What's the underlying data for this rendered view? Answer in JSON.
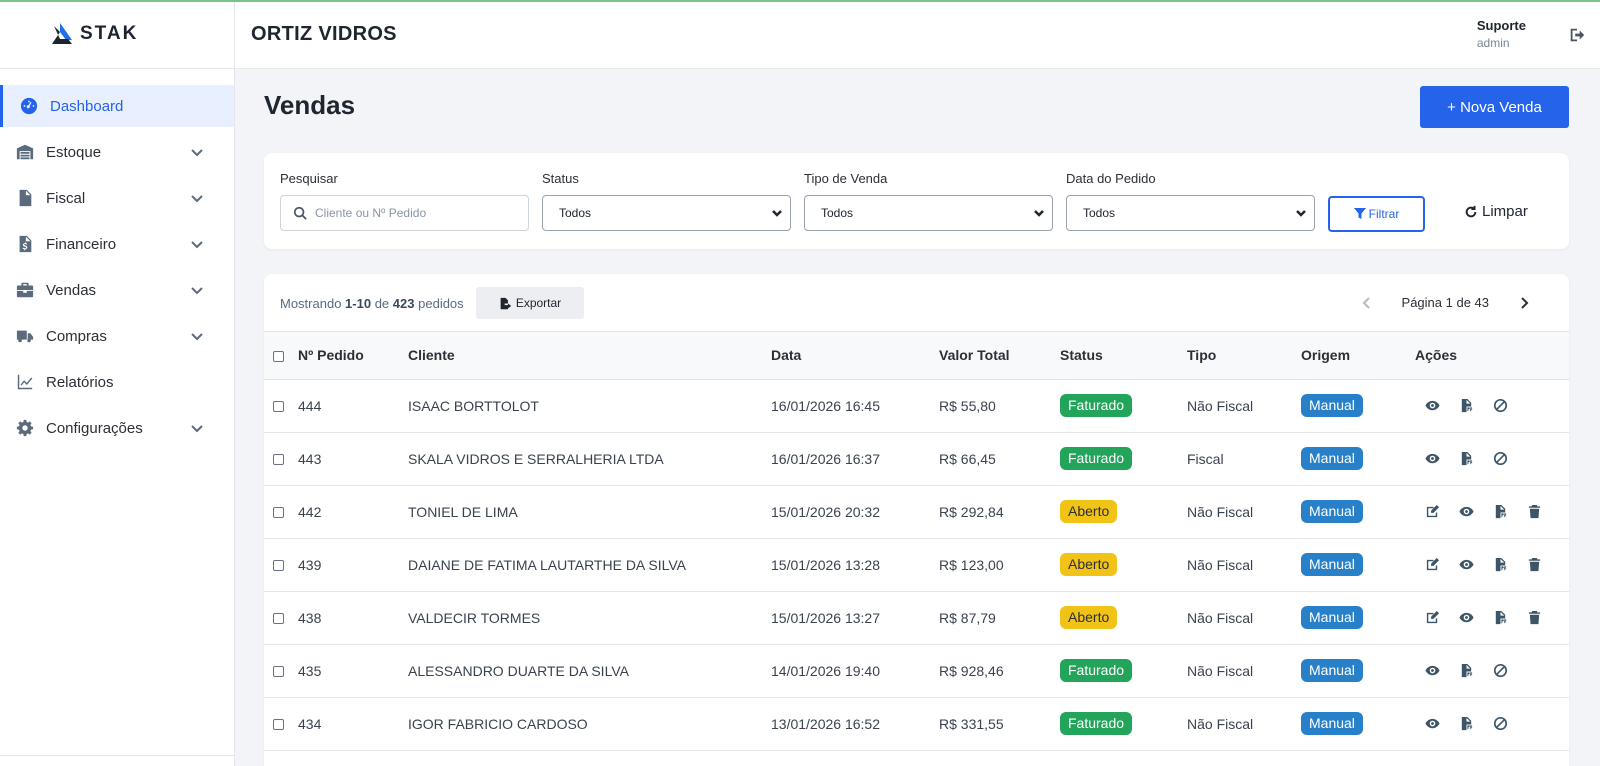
{
  "brand": {
    "name": "STAK"
  },
  "header": {
    "company": "ORTIZ VIDROS",
    "user_name": "Suporte",
    "user_role": "admin"
  },
  "sidebar": {
    "items": [
      {
        "label": "Dashboard",
        "icon": "gauge-icon",
        "active": true
      },
      {
        "label": "Estoque",
        "icon": "warehouse-icon"
      },
      {
        "label": "Fiscal",
        "icon": "invoice-icon"
      },
      {
        "label": "Financeiro",
        "icon": "dollar-file-icon"
      },
      {
        "label": "Vendas",
        "icon": "briefcase-icon"
      },
      {
        "label": "Compras",
        "icon": "truck-icon"
      },
      {
        "label": "Relatórios",
        "icon": "chart-line-icon"
      },
      {
        "label": "Configurações",
        "icon": "gear-icon"
      }
    ]
  },
  "page": {
    "title": "Vendas",
    "new_button": "+ Nova Venda"
  },
  "filters": {
    "search_label": "Pesquisar",
    "search_placeholder": "Cliente ou Nº Pedido",
    "status_label": "Status",
    "status_value": "Todos",
    "type_label": "Tipo de Venda",
    "type_value": "Todos",
    "date_label": "Data do Pedido",
    "date_value": "Todos",
    "filter_button": "Filtrar",
    "clear_button": "Limpar"
  },
  "list": {
    "showing_prefix": "Mostrando",
    "range": "1-10",
    "of": "de",
    "total": "423",
    "suffix": "pedidos",
    "export_button": "Exportar",
    "page_text": "Página 1 de 43"
  },
  "table": {
    "headers": [
      "Nº Pedido",
      "Cliente",
      "Data",
      "Valor Total",
      "Status",
      "Tipo",
      "Origem",
      "Ações"
    ],
    "rows": [
      {
        "id": "444",
        "client": "ISAAC BORTTOLOT",
        "date": "16/01/2026 16:45",
        "total": "R$ 55,80",
        "status": "Faturado",
        "type": "Não Fiscal",
        "origin": "Manual"
      },
      {
        "id": "443",
        "client": "SKALA VIDROS E SERRALHERIA LTDA",
        "date": "16/01/2026 16:37",
        "total": "R$ 66,45",
        "status": "Faturado",
        "type": "Fiscal",
        "origin": "Manual"
      },
      {
        "id": "442",
        "client": "TONIEL DE LIMA",
        "date": "15/01/2026 20:32",
        "total": "R$ 292,84",
        "status": "Aberto",
        "type": "Não Fiscal",
        "origin": "Manual"
      },
      {
        "id": "439",
        "client": "DAIANE DE FATIMA LAUTARTHE DA SILVA",
        "date": "15/01/2026 13:28",
        "total": "R$ 123,00",
        "status": "Aberto",
        "type": "Não Fiscal",
        "origin": "Manual"
      },
      {
        "id": "438",
        "client": "VALDECIR TORMES",
        "date": "15/01/2026 13:27",
        "total": "R$ 87,79",
        "status": "Aberto",
        "type": "Não Fiscal",
        "origin": "Manual"
      },
      {
        "id": "435",
        "client": "ALESSANDRO DUARTE DA SILVA",
        "date": "14/01/2026 19:40",
        "total": "R$ 928,46",
        "status": "Faturado",
        "type": "Não Fiscal",
        "origin": "Manual"
      },
      {
        "id": "434",
        "client": "IGOR FABRICIO CARDOSO",
        "date": "13/01/2026 16:52",
        "total": "R$ 331,55",
        "status": "Faturado",
        "type": "Não Fiscal",
        "origin": "Manual"
      }
    ]
  },
  "colors": {
    "accent": "#2563eb",
    "faturado": "#22a55b",
    "aberto": "#f2c317",
    "manual": "#2780c8"
  }
}
